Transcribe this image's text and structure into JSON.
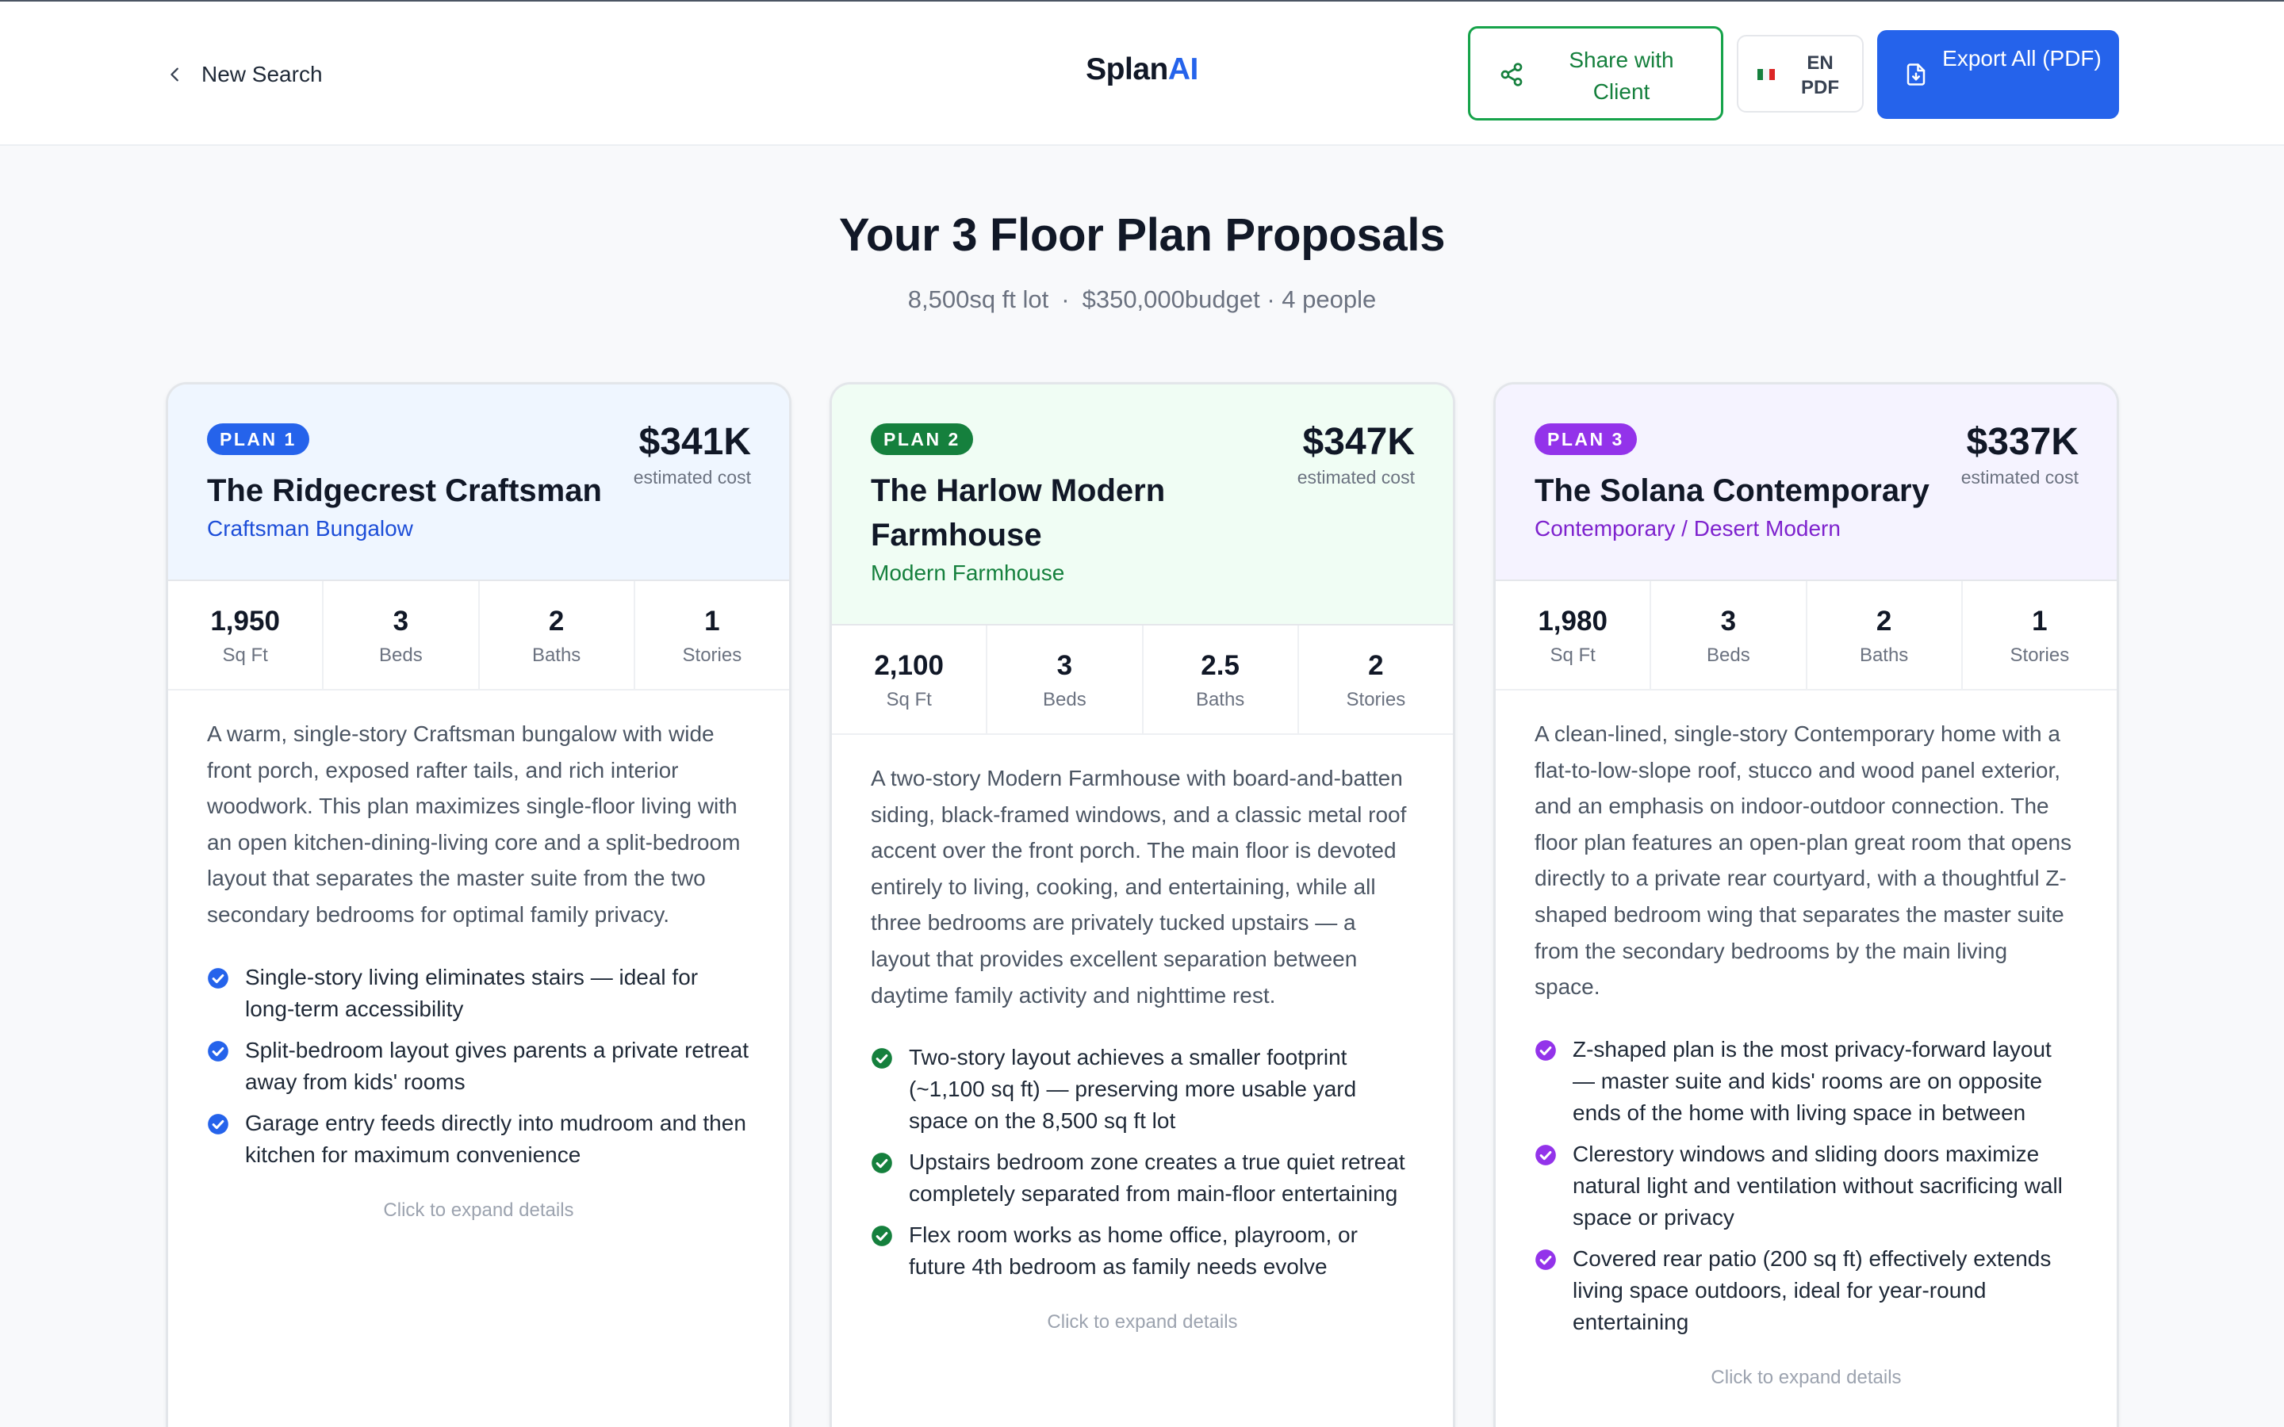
{
  "header": {
    "back_label": "New Search",
    "logo_part1": "Splan",
    "logo_part2": "AI",
    "share_label": "Share with Client",
    "lang_label": "EN PDF",
    "export_label": "Export All (PDF)"
  },
  "summary": {
    "title": "Your 3 Floor Plan Proposals",
    "lot": "8,500sq ft lot",
    "budget": "$350,000budget",
    "people": "· 4 people",
    "separator": "·"
  },
  "colors": {
    "accent_blue": "#2563eb",
    "accent_green": "#15803d",
    "accent_purple": "#9333ea"
  },
  "plans": [
    {
      "badge": "PLAN 1",
      "name": "The Ridgecrest Craftsman",
      "style": "Craftsman Bungalow",
      "price": "$341K",
      "price_caption": "estimated cost",
      "stats": [
        {
          "value": "1,950",
          "label": "Sq Ft"
        },
        {
          "value": "3",
          "label": "Beds"
        },
        {
          "value": "2",
          "label": "Baths"
        },
        {
          "value": "1",
          "label": "Stories"
        }
      ],
      "description": "A warm, single-story Craftsman bungalow with wide front porch, exposed rafter tails, and rich interior woodwork. This plan maximizes single-floor living with an open kitchen-dining-living core and a split-bedroom layout that separates the master suite from the two secondary bedrooms for optimal family privacy.",
      "features": [
        "Single-story living eliminates stairs — ideal for long-term accessibility",
        "Split-bedroom layout gives parents a private retreat away from kids' rooms",
        "Garage entry feeds directly into mudroom and then kitchen for maximum convenience"
      ],
      "expand_hint": "Click to expand details"
    },
    {
      "badge": "PLAN 2",
      "name": "The Harlow Modern Farmhouse",
      "style": "Modern Farmhouse",
      "price": "$347K",
      "price_caption": "estimated cost",
      "stats": [
        {
          "value": "2,100",
          "label": "Sq Ft"
        },
        {
          "value": "3",
          "label": "Beds"
        },
        {
          "value": "2.5",
          "label": "Baths"
        },
        {
          "value": "2",
          "label": "Stories"
        }
      ],
      "description": "A two-story Modern Farmhouse with board-and-batten siding, black-framed windows, and a classic metal roof accent over the front porch. The main floor is devoted entirely to living, cooking, and entertaining, while all three bedrooms are privately tucked upstairs — a layout that provides excellent separation between daytime family activity and nighttime rest.",
      "features": [
        "Two-story layout achieves a smaller footprint (~1,100 sq ft) — preserving more usable yard space on the 8,500 sq ft lot",
        "Upstairs bedroom zone creates a true quiet retreat completely separated from main-floor entertaining",
        "Flex room works as home office, playroom, or future 4th bedroom as family needs evolve"
      ],
      "expand_hint": "Click to expand details"
    },
    {
      "badge": "PLAN 3",
      "name": "The Solana Contemporary",
      "style": "Contemporary / Desert Modern",
      "price": "$337K",
      "price_caption": "estimated cost",
      "stats": [
        {
          "value": "1,980",
          "label": "Sq Ft"
        },
        {
          "value": "3",
          "label": "Beds"
        },
        {
          "value": "2",
          "label": "Baths"
        },
        {
          "value": "1",
          "label": "Stories"
        }
      ],
      "description": "A clean-lined, single-story Contemporary home with a flat-to-low-slope roof, stucco and wood panel exterior, and an emphasis on indoor-outdoor connection. The floor plan features an open-plan great room that opens directly to a private rear courtyard, with a thoughtful Z-shaped bedroom wing that separates the master suite from the secondary bedrooms by the main living space.",
      "features": [
        "Z-shaped plan is the most privacy-forward layout — master suite and kids' rooms are on opposite ends of the home with living space in between",
        "Clerestory windows and sliding doors maximize natural light and ventilation without sacrificing wall space or privacy",
        "Covered rear patio (200 sq ft) effectively extends living space outdoors, ideal for year-round entertaining"
      ],
      "expand_hint": "Click to expand details"
    }
  ]
}
